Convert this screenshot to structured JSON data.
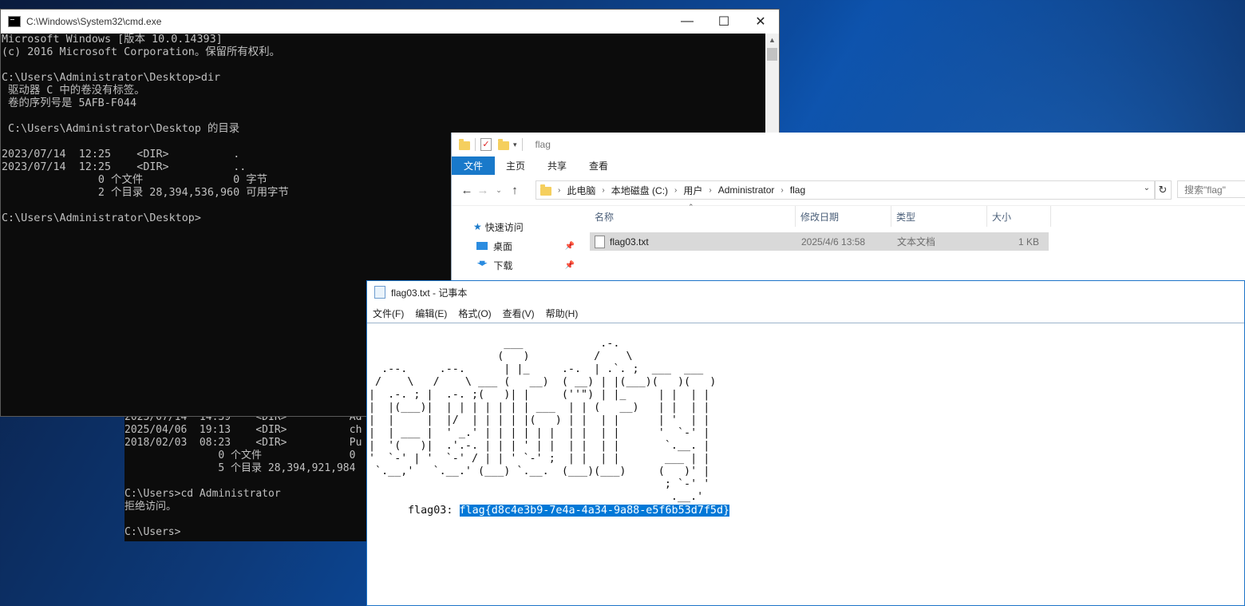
{
  "cmd": {
    "title": "C:\\Windows\\System32\\cmd.exe",
    "lines": [
      "Microsoft Windows [版本 10.0.14393]",
      "(c) 2016 Microsoft Corporation。保留所有权利。",
      "",
      "C:\\Users\\Administrator\\Desktop>dir",
      " 驱动器 C 中的卷没有标签。",
      " 卷的序列号是 5AFB-F044",
      "",
      " C:\\Users\\Administrator\\Desktop 的目录",
      "",
      "2023/07/14  12:25    <DIR>          .",
      "2023/07/14  12:25    <DIR>          ..",
      "               0 个文件              0 字节",
      "               2 个目录 28,394,536,960 可用字节",
      "",
      "C:\\Users\\Administrator\\Desktop>"
    ]
  },
  "cmd_back": {
    "lines": [
      "2023/07/14  14:39    <DIR>          Ad",
      "2025/04/06  19:13    <DIR>          ch",
      "2018/02/03  08:23    <DIR>          Pu",
      "               0 个文件              0",
      "               5 个目录 28,394,921,984",
      "",
      "C:\\Users>cd Administrator",
      "拒绝访问。",
      "",
      "C:\\Users>"
    ]
  },
  "explorer": {
    "title": "flag",
    "tabs": [
      "文件",
      "主页",
      "共享",
      "查看"
    ],
    "breadcrumb": [
      "此电脑",
      "本地磁盘 (C:)",
      "用户",
      "Administrator",
      "flag"
    ],
    "search_placeholder": "搜索\"flag\"",
    "nav": [
      {
        "label": "快速访问"
      },
      {
        "label": "桌面"
      },
      {
        "label": "下载"
      }
    ],
    "columns": [
      "名称",
      "修改日期",
      "类型",
      "大小"
    ],
    "files": [
      {
        "name": "flag03.txt",
        "modified": "2025/4/6 13:58",
        "type": "文本文档",
        "size": "1 KB"
      }
    ]
  },
  "notepad": {
    "title": "flag03.txt - 记事本",
    "menu": [
      "文件(F)",
      "编辑(E)",
      "格式(O)",
      "查看(V)",
      "帮助(H)"
    ],
    "ascii_art": "                     ___            .-.                  \n                    (   )          /    \\                 \n  .--.     .--.      | |_     .-.  | .`. ;  ___  ___   \n /    \\   /    \\ ___ (   __)  ( __) | |(___)(   )(   )  \n|  .-. ; |  .-. ;(   )| |     (''\") | |_     | |  | |   \n|  |(___)|  | | | | | | | ___  | | (   __)   | |  | |   \n|  |     |  |/  | | | | |(   ) | |  | |      | '  | |   \n|  | ___ |  ' _.' | | | | | |  | |  | |      '  `-' |   \n|  '(   )|  .'.-. | | | ' | |  | |  | |       `.__. |   \n'  `-' | '  `-' / | | ' `-' ;  | |  | |       ___ | |   \n `.__,'   `.__.' (___) `.__.  (___)(___)     (   )' |   \n                                              ; `-' '   \n                                               .__.'    ",
    "flag_label": "flag03:",
    "flag_value": "flag{d8c4e3b9-7e4a-4a34-9a88-e5f6b53d7f5d}"
  }
}
